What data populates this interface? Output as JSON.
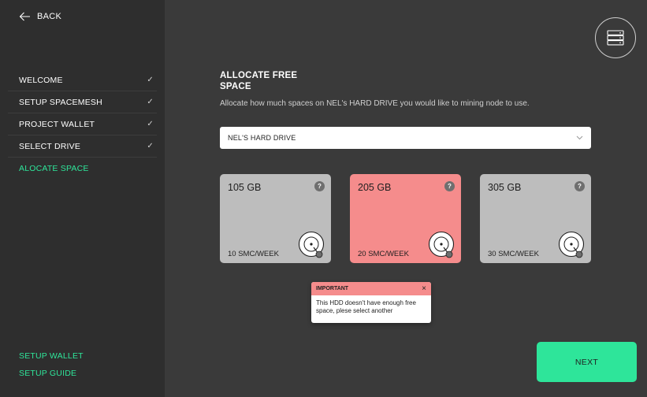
{
  "sidebar": {
    "back_label": "BACK",
    "steps": [
      {
        "label": "WELCOME",
        "done": "✓"
      },
      {
        "label": "SETUP SPACEMESH",
        "done": "✓"
      },
      {
        "label": "PROJECT WALLET",
        "done": "✓"
      },
      {
        "label": "SELECT DRIVE",
        "done": "✓"
      },
      {
        "label": "ALOCATE SPACE",
        "done": ""
      }
    ],
    "bottom_links": [
      "SETUP WALLET",
      "SETUP GUIDE"
    ]
  },
  "main": {
    "title": "ALLOCATE FREE SPACE",
    "subtitle": "Allocate how much spaces on NEL's HARD DRIVE you would like to mining node to use.",
    "drive_select": {
      "value": "NEL'S HARD DRIVE"
    },
    "options": [
      {
        "size": "105 GB",
        "rate": "10 SMC/WEEK",
        "selected": false
      },
      {
        "size": "205 GB",
        "rate": "20 SMC/WEEK",
        "selected": true
      },
      {
        "size": "305 GB",
        "rate": "30 SMC/WEEK",
        "selected": false
      }
    ],
    "help_glyph": "?",
    "tooltip": {
      "title": "IMPORTANT",
      "close": "×",
      "message": "This HDD doesn't have enough free space, plese select another"
    },
    "next_label": "NEXT"
  },
  "colors": {
    "accent_green": "#2ee59a",
    "selected_card": "#f58c8c",
    "card": "#bdbdbd",
    "sidebar_bg": "#2e2e2e",
    "main_bg": "#3a3a3a"
  },
  "icons": {
    "back": "arrow-left-icon",
    "server": "server-stack-icon",
    "disk": "hard-drive-disk-icon",
    "chevron": "chevron-down-icon"
  }
}
